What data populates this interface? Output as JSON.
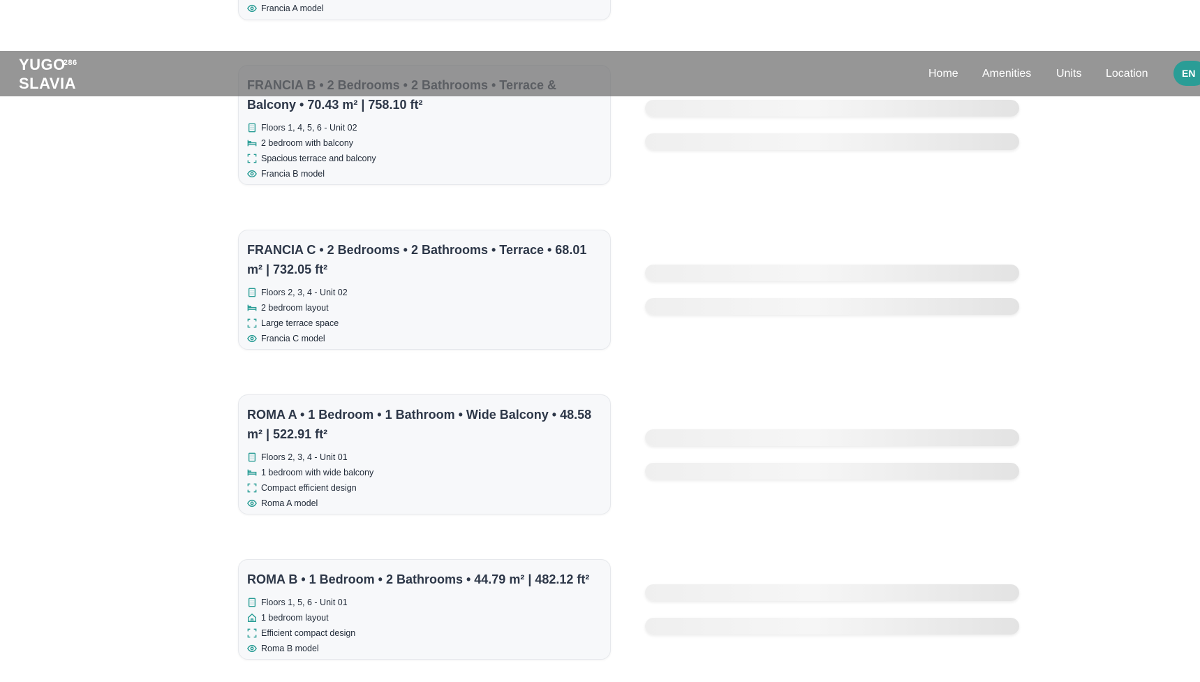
{
  "nav": {
    "logo_line1": "YUGO",
    "logo_number": "286",
    "logo_line2": "SLAVIA",
    "links": [
      "Home",
      "Amenities",
      "Units",
      "Location"
    ],
    "language": "EN"
  },
  "units": [
    {
      "title": "",
      "features": [
        {
          "icon": "eye-icon",
          "text": "Francia A model"
        }
      ]
    },
    {
      "title": "FRANCIA B • 2 Bedrooms • 2 Bathrooms • Terrace & Balcony • 70.43 m² | 758.10 ft²",
      "features": [
        {
          "icon": "building-icon",
          "text": "Floors 1, 4, 5, 6 - Unit 02"
        },
        {
          "icon": "bed-icon",
          "text": "2 bedroom with balcony"
        },
        {
          "icon": "expand-icon",
          "text": "Spacious terrace and balcony"
        },
        {
          "icon": "eye-icon",
          "text": "Francia B model"
        }
      ]
    },
    {
      "title": "FRANCIA C • 2 Bedrooms • 2 Bathrooms • Terrace • 68.01 m² | 732.05 ft²",
      "features": [
        {
          "icon": "building-icon",
          "text": "Floors 2, 3, 4 - Unit 02"
        },
        {
          "icon": "bed-icon",
          "text": "2 bedroom layout"
        },
        {
          "icon": "expand-icon",
          "text": "Large terrace space"
        },
        {
          "icon": "eye-icon",
          "text": "Francia C model"
        }
      ]
    },
    {
      "title": "ROMA A • 1 Bedroom • 1 Bathroom • Wide Balcony • 48.58 m² | 522.91 ft²",
      "features": [
        {
          "icon": "building-icon",
          "text": "Floors 2, 3, 4 - Unit 01"
        },
        {
          "icon": "bed-icon",
          "text": "1 bedroom with wide balcony"
        },
        {
          "icon": "expand-icon",
          "text": "Compact efficient design"
        },
        {
          "icon": "eye-icon",
          "text": "Roma A model"
        }
      ]
    },
    {
      "title": "ROMA B • 1 Bedroom • 2 Bathrooms • 44.79 m² | 482.12 ft²",
      "features": [
        {
          "icon": "building-icon",
          "text": "Floors 1, 5, 6 - Unit 01"
        },
        {
          "icon": "home-icon",
          "text": "1 bedroom layout"
        },
        {
          "icon": "expand-icon",
          "text": "Efficient compact design"
        },
        {
          "icon": "eye-icon",
          "text": "Roma B model"
        }
      ]
    }
  ],
  "colors": {
    "accent": "#2a9d96",
    "navbar_overlay": "#6e6e6e",
    "card_bg": "#f7f8fa",
    "title_text": "#2d3748"
  }
}
